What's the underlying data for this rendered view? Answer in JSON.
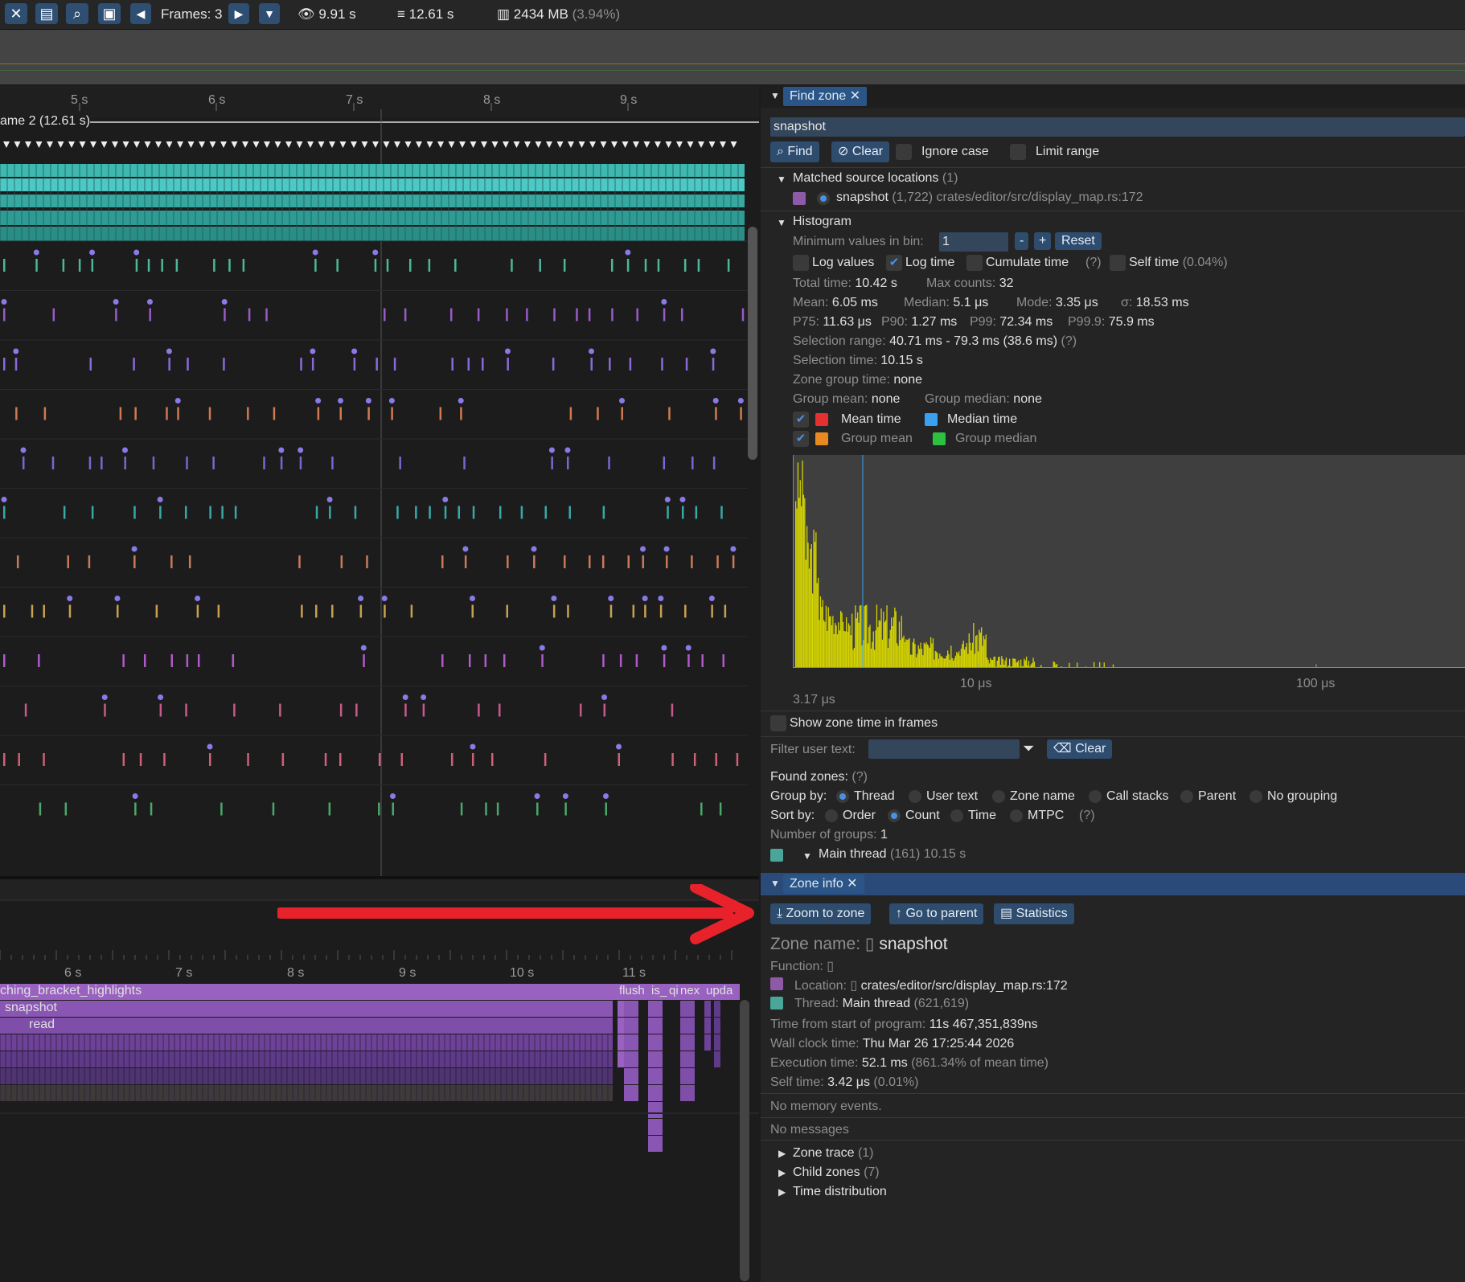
{
  "toolbar": {
    "frames_label": "Frames: 3",
    "view_time": "9.91 s",
    "total_time": "12.61 s",
    "memory": "2434 MB",
    "memory_pct": "(3.94%)"
  },
  "timeline": {
    "ticks": [
      "5 s",
      "6 s",
      "7 s",
      "8 s",
      "9 s"
    ],
    "frame_label": "ame 2 (12.61 s)"
  },
  "flame": {
    "ticks": [
      "6 s",
      "7 s",
      "8 s",
      "9 s",
      "10 s",
      "11 s"
    ],
    "bars": [
      "ching_bracket_highlights",
      "snapshot",
      "read"
    ],
    "right_labels": [
      "flush",
      "is_",
      "qi",
      "nex",
      "upda"
    ]
  },
  "find_zone": {
    "tab": "Find zone",
    "query": "snapshot",
    "find": "Find",
    "clear": "Clear",
    "ignore_case": "Ignore case",
    "limit_range": "Limit range",
    "matched_header": "Matched source locations",
    "matched_count": "(1)",
    "match_name": "snapshot",
    "match_detail": "(1,722) crates/editor/src/display_map.rs:172",
    "histogram": "Histogram",
    "min_values_label": "Minimum values in bin:",
    "min_values": "1",
    "minus": "-",
    "plus": "+",
    "reset": "Reset",
    "log_values": "Log values",
    "log_time": "Log time",
    "cumulate_time": "Cumulate time",
    "q": "(?)",
    "self_time": "Self time",
    "self_time_pct": "(0.04%)",
    "total_time_label": "Total time:",
    "total_time": "10.42 s",
    "max_counts_label": "Max counts:",
    "max_counts": "32",
    "mean_label": "Mean:",
    "mean": "6.05 ms",
    "median_label": "Median:",
    "median": "5.1 μs",
    "mode_label": "Mode:",
    "mode": "3.35 μs",
    "sigma_label": "σ:",
    "sigma": "18.53 ms",
    "p75_label": "P75:",
    "p75": "11.63 μs",
    "p90_label": "P90:",
    "p90": "1.27 ms",
    "p99_label": "P99:",
    "p99": "72.34 ms",
    "p999_label": "P99.9:",
    "p999": "75.9 ms",
    "sel_range_label": "Selection range:",
    "sel_range": "40.71 ms - 79.3 ms (38.6 ms)",
    "sel_time_label": "Selection time:",
    "sel_time": "10.15 s",
    "zgt_label": "Zone group time:",
    "zgt": "none",
    "gmean_label": "Group mean:",
    "gmean": "none",
    "gmedian_label": "Group median:",
    "gmedian": "none",
    "mean_time": "Mean time",
    "median_time": "Median time",
    "group_mean": "Group mean",
    "group_median": "Group median",
    "axis_min": "3.17 μs",
    "axis_10": "10 μs",
    "axis_100": "100 μs",
    "show_zone_time": "Show zone time in frames",
    "filter_label": "Filter user text:",
    "filter_clear": "Clear",
    "found_zones": "Found zones:",
    "group_by": "Group by:",
    "group_opts": [
      "Thread",
      "User text",
      "Zone name",
      "Call stacks",
      "Parent",
      "No grouping"
    ],
    "sort_by": "Sort by:",
    "sort_opts": [
      "Order",
      "Count",
      "Time",
      "MTPC"
    ],
    "num_groups_label": "Number of groups:",
    "num_groups": "1",
    "group_name": "Main thread",
    "group_detail": "(161) 10.15 s",
    "colors": {
      "mean": "#e53030",
      "median": "#3aa0f0",
      "gmean": "#e88a20",
      "gmedian": "#2ec040",
      "match": "#8e5aa8",
      "thread": "#4aa59a",
      "hist": "#d4d400"
    }
  },
  "histogram_data": {
    "type": "bar",
    "x_scale": "log",
    "xlim_us": [
      3.17,
      200
    ],
    "note_peak_at_us": 3.35
  },
  "zone_info": {
    "tab": "Zone info",
    "zoom": "Zoom to zone",
    "parent": "Go to parent",
    "statistics": "Statistics",
    "zone_name_label": "Zone name:",
    "zone_name": "snapshot",
    "function_label": "Function:",
    "location_label": "Location:",
    "location": "crates/editor/src/display_map.rs:172",
    "thread_label": "Thread:",
    "thread": "Main thread",
    "thread_id": "(621,619)",
    "tfs_label": "Time from start of program:",
    "tfs": "11s 467,351,839ns",
    "wall_label": "Wall clock time:",
    "wall": "Thu Mar 26 17:25:44 2026",
    "exec_label": "Execution time:",
    "exec": "52.1 ms",
    "exec_pct": "(861.34% of mean time)",
    "self_label": "Self time:",
    "self": "3.42 μs",
    "self_pct": "(0.01%)",
    "no_mem": "No memory events.",
    "no_msg": "No messages",
    "zone_trace": "Zone trace",
    "zone_trace_n": "(1)",
    "child_zones": "Child zones",
    "child_zones_n": "(7)",
    "time_dist": "Time distribution"
  }
}
